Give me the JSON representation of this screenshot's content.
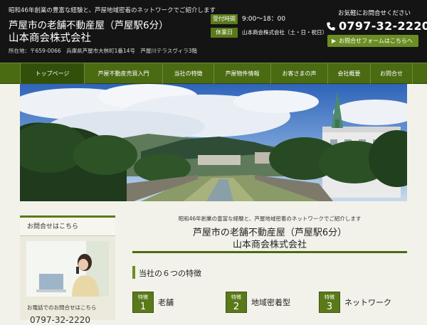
{
  "header": {
    "tagline": "昭和46年創業の豊富な経験と、芦屋地域密着のネットワークでご紹介します",
    "title_line1": "芦屋市の老舗不動産屋（芦屋駅6分）",
    "title_line2": "山本商会株式会社",
    "address": "所在地：〒659-0066　兵庫県芦屋市大桝町1番14号　芦屋川テラスヴィラ3階",
    "hours_label": "受付時間",
    "hours_value": "9:00～18：00",
    "closed_label": "休業日",
    "closed_value": "山本商会株式会社（土・日・祝日）",
    "contact_lead": "お気軽にお問合せください",
    "phone": "0797-32-2220",
    "form_button": "お問合せフォームはこちらへ"
  },
  "nav": {
    "items": [
      {
        "label": "トップページ"
      },
      {
        "label": "芦屋不動産売買入門"
      },
      {
        "label": "当社の特徴"
      },
      {
        "label": "芦屋物件情報"
      },
      {
        "label": "お客さまの声"
      },
      {
        "label": "会社概要"
      },
      {
        "label": "お問合せ"
      }
    ]
  },
  "sidebar": {
    "title": "お問合せはこちら",
    "phone_note": "お電話でのお問合せはこちら",
    "phone": "0797-32-2220"
  },
  "main": {
    "tagline": "昭和46年創業の豊富な経験と、芦屋地域密着のネットワークでご紹介します",
    "title_line1": "芦屋市の老舗不動産屋（芦屋駅6分）",
    "title_line2": "山本商会株式会社",
    "section_title": "当社の６つの特徴",
    "features": [
      {
        "badge": "特徴",
        "num": "1",
        "text": "老舗"
      },
      {
        "badge": "特徴",
        "num": "2",
        "text": "地域密着型"
      },
      {
        "badge": "特徴",
        "num": "3",
        "text": "ネットワーク"
      }
    ]
  },
  "colors": {
    "nav_bg": "#4a6b12",
    "accent": "#5a7a1a",
    "header_bg": "#141414"
  }
}
